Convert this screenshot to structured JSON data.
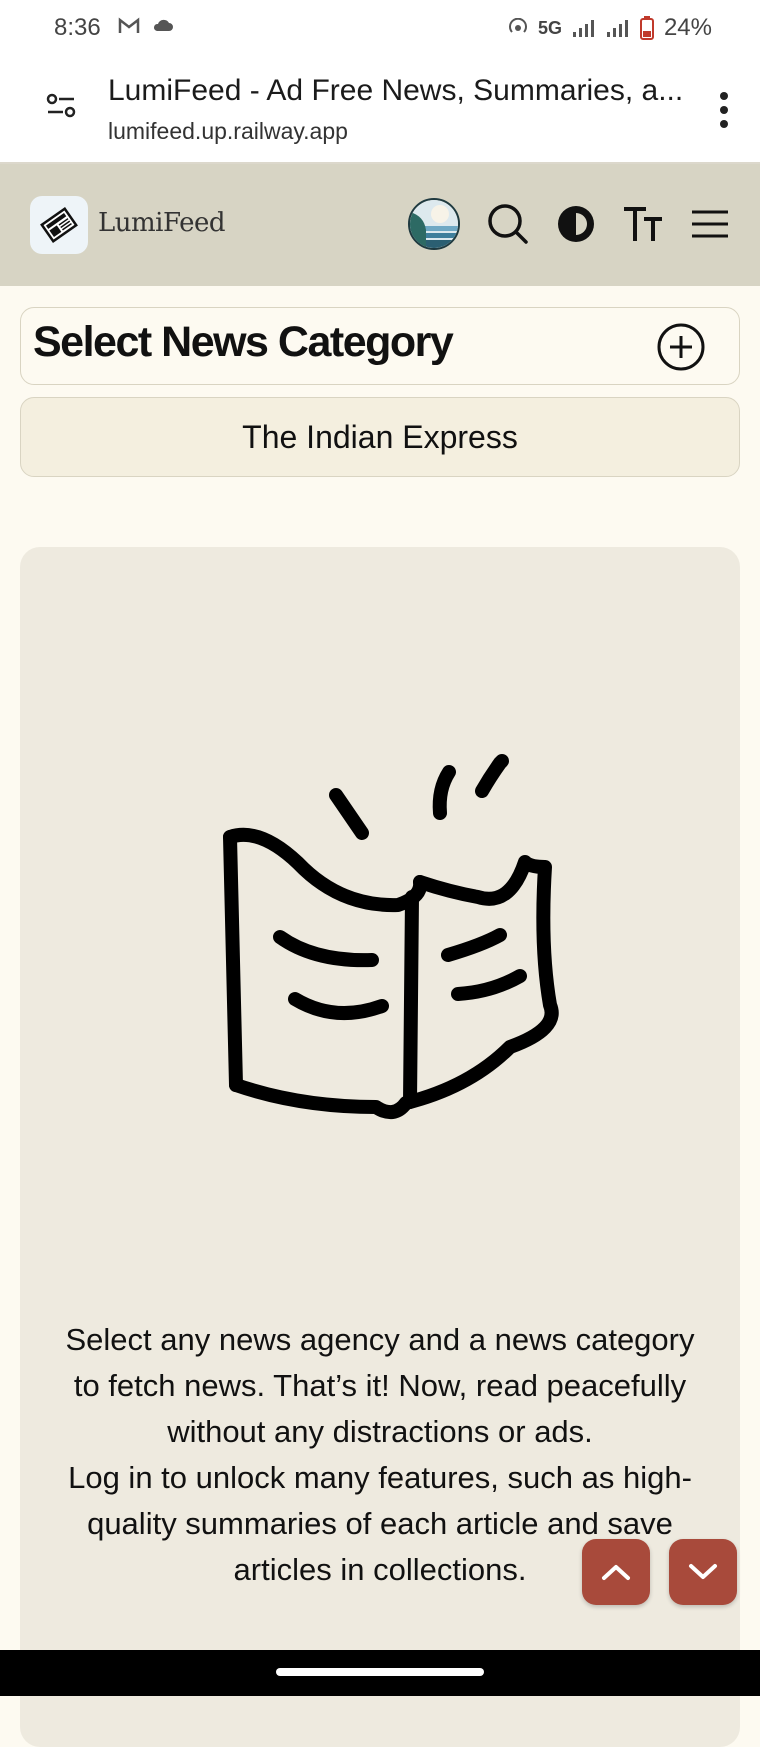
{
  "status_bar": {
    "time": "8:36",
    "network": "5G",
    "battery": "24%"
  },
  "browser": {
    "page_title": "LumiFeed - Ad Free News, Summaries, a...",
    "url": "lumifeed.up.railway.app"
  },
  "header": {
    "brand": "LumiFeed"
  },
  "category": {
    "label": "Select News Category"
  },
  "agency": {
    "selected": "The Indian Express"
  },
  "intro": {
    "line1": "Select any news agency and a news category to fetch news. That’s it! Now, read peacefully without any distractions or ads.",
    "line2": "Log in to unlock many features, such as high-quality summaries of each article and save articles in collections."
  },
  "colors": {
    "header_bg": "#d7d4c4",
    "page_bg": "#fdfaf1",
    "card_bg": "#eeeadf",
    "fab_bg": "#a84a3b"
  }
}
